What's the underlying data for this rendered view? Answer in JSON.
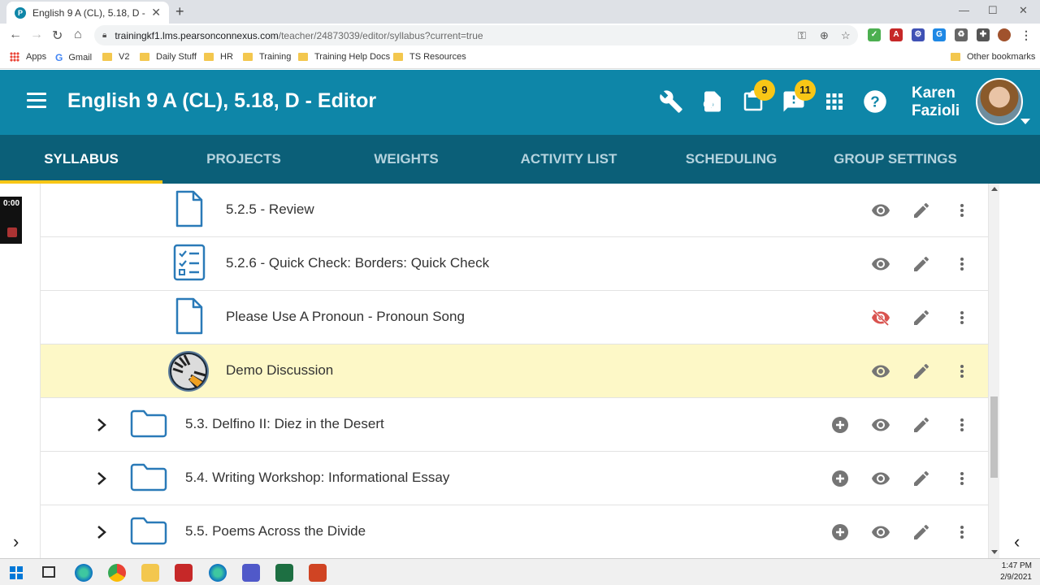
{
  "browser": {
    "tab_title": "English 9 A (CL), 5.18, D - Editor",
    "url_host": "trainingkf1.lms.pearsonconnexus.com",
    "url_path": "/teacher/24873039/editor/syllabus?current=true",
    "bookmarks": [
      "Apps",
      "Gmail",
      "V2",
      "Daily Stuff",
      "HR",
      "Training",
      "Training Help Docs",
      "TS Resources"
    ],
    "other_bookmarks": "Other bookmarks"
  },
  "header": {
    "title": "English 9 A (CL), 5.18, D - Editor",
    "clipboard_badge": "9",
    "alerts_badge": "11",
    "user_first": "Karen",
    "user_last": "Fazioli"
  },
  "tabs": [
    {
      "label": "SYLLABUS",
      "active": true
    },
    {
      "label": "PROJECTS"
    },
    {
      "label": "WEIGHTS"
    },
    {
      "label": "ACTIVITY LIST"
    },
    {
      "label": "SCHEDULING"
    },
    {
      "label": "GROUP SETTINGS"
    }
  ],
  "recorder": {
    "time": "0:00"
  },
  "syllabus": {
    "rows": [
      {
        "label": "5.2.5 - Review",
        "icon": "document-icon"
      },
      {
        "label": "5.2.6 - Quick Check: Borders: Quick Check",
        "icon": "checklist-icon"
      },
      {
        "label": "Please Use A Pronoun - Pronoun Song",
        "icon": "document-icon",
        "hidden": true
      },
      {
        "label": "Demo Discussion",
        "icon": "discussion-icon",
        "highlighted": true
      },
      {
        "label": "5.3. Delfino II: Diez in the Desert",
        "icon": "folder-icon",
        "folder": true
      },
      {
        "label": "5.4. Writing Workshop: Informational Essay",
        "icon": "folder-icon",
        "folder": true
      },
      {
        "label": "5.5. Poems Across the Divide",
        "icon": "folder-icon",
        "folder": true
      }
    ]
  },
  "taskbar": {
    "time": "1:47 PM",
    "date": "2/9/2021"
  },
  "colors": {
    "header": "#0e86a8",
    "tabs": "#0b5f78",
    "accent": "#f8c616",
    "highlight": "#fdf8c7",
    "hidden_eye": "#d9534f"
  }
}
